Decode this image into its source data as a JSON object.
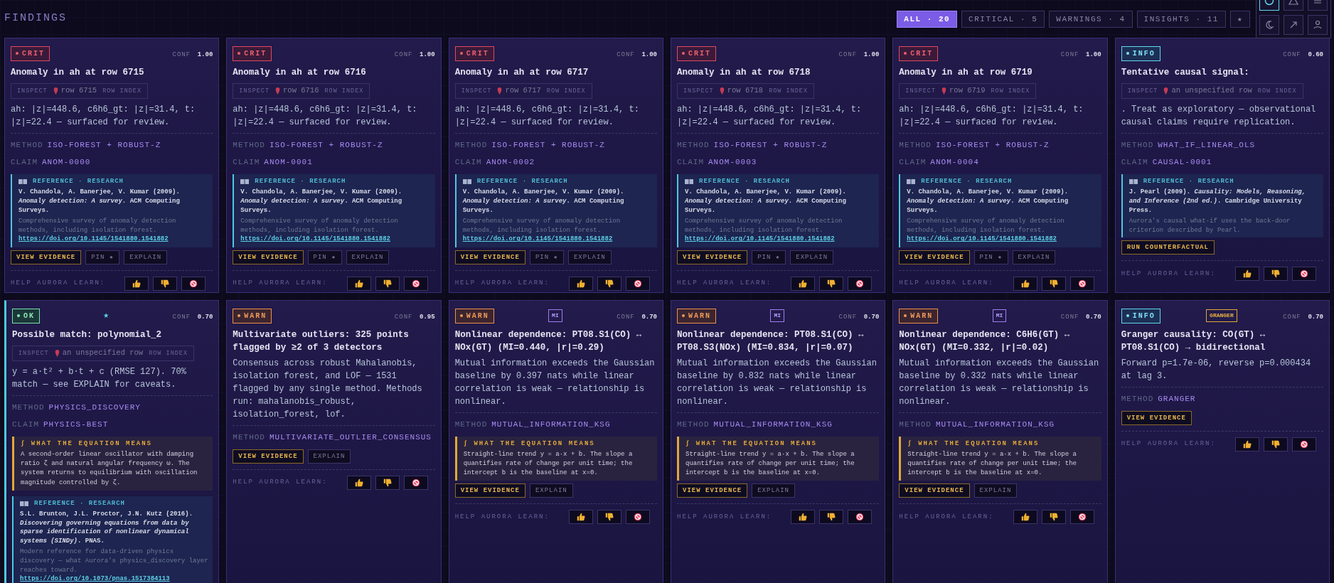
{
  "header": {
    "title": "FINDINGS"
  },
  "filters": [
    {
      "text": "ALL · 20",
      "selected": true
    },
    {
      "text": "CRITICAL · 5",
      "selected": false
    },
    {
      "text": "WARNINGS · 4",
      "selected": false
    },
    {
      "text": "INSIGHTS · 11",
      "selected": false
    },
    {
      "text": "★",
      "selected": false
    }
  ],
  "view_tools": [
    {
      "selected": true
    },
    {
      "selected": false
    },
    {
      "selected": false
    },
    {
      "selected": false
    },
    {
      "selected": false
    },
    {
      "selected": false
    }
  ],
  "cards": [
    {
      "kind": "crit",
      "badge": "CRIT",
      "conf_label": "CONF",
      "conf": "1.00",
      "title": "Anomaly in ah at row 6715",
      "inspect": {
        "label": "INSPECT",
        "row": "row 6715",
        "hint": "ROW INDEX"
      },
      "body": "ah: |z|=448.6, c6h6_gt: |z|=31.4, t: |z|=22.4 — surfaced for review.",
      "fields": [
        {
          "label": "METHOD",
          "value": "ISO-FOREST + ROBUST-Z"
        },
        {
          "label": "CLAIM",
          "value": "ANOM-0000"
        }
      ],
      "reference": {
        "header": "REFERENCE · RESEARCH",
        "citation": "V. Chandola, A. Banerjee, V. Kumar (2009). *Anomaly detection: A survey*. ACM Computing Surveys.",
        "note": "Comprehensive survey of anomaly detection methods, including isolation forest.",
        "url": "https://doi.org/10.1145/1541880.1541882"
      },
      "buttons": [
        {
          "text": "VIEW EVIDENCE",
          "kind": "primary"
        },
        {
          "text": "PIN ★",
          "kind": "secondary"
        },
        {
          "text": "EXPLAIN",
          "kind": "secondary"
        }
      ],
      "feedback": {
        "label": "HELP AURORA LEARN:"
      }
    },
    {
      "kind": "crit",
      "badge": "CRIT",
      "conf_label": "CONF",
      "conf": "1.00",
      "title": "Anomaly in ah at row 6716",
      "inspect": {
        "label": "INSPECT",
        "row": "row 6716",
        "hint": "ROW INDEX"
      },
      "body": "ah: |z|=448.6, c6h6_gt: |z|=31.4, t: |z|=22.4 — surfaced for review.",
      "fields": [
        {
          "label": "METHOD",
          "value": "ISO-FOREST + ROBUST-Z"
        },
        {
          "label": "CLAIM",
          "value": "ANOM-0001"
        }
      ],
      "reference": {
        "header": "REFERENCE · RESEARCH",
        "citation": "V. Chandola, A. Banerjee, V. Kumar (2009). *Anomaly detection: A survey*. ACM Computing Surveys.",
        "note": "Comprehensive survey of anomaly detection methods, including isolation forest.",
        "url": "https://doi.org/10.1145/1541880.1541882"
      },
      "buttons": [
        {
          "text": "VIEW EVIDENCE",
          "kind": "primary"
        },
        {
          "text": "PIN ★",
          "kind": "secondary"
        },
        {
          "text": "EXPLAIN",
          "kind": "secondary"
        }
      ],
      "feedback": {
        "label": "HELP AURORA LEARN:"
      }
    },
    {
      "kind": "crit",
      "badge": "CRIT",
      "conf_label": "CONF",
      "conf": "1.00",
      "title": "Anomaly in ah at row 6717",
      "inspect": {
        "label": "INSPECT",
        "row": "row 6717",
        "hint": "ROW INDEX"
      },
      "body": "ah: |z|=448.6, c6h6_gt: |z|=31.4, t: |z|=22.4 — surfaced for review.",
      "fields": [
        {
          "label": "METHOD",
          "value": "ISO-FOREST + ROBUST-Z"
        },
        {
          "label": "CLAIM",
          "value": "ANOM-0002"
        }
      ],
      "reference": {
        "header": "REFERENCE · RESEARCH",
        "citation": "V. Chandola, A. Banerjee, V. Kumar (2009). *Anomaly detection: A survey*. ACM Computing Surveys.",
        "note": "Comprehensive survey of anomaly detection methods, including isolation forest.",
        "url": "https://doi.org/10.1145/1541880.1541882"
      },
      "buttons": [
        {
          "text": "VIEW EVIDENCE",
          "kind": "primary"
        },
        {
          "text": "PIN ★",
          "kind": "secondary"
        },
        {
          "text": "EXPLAIN",
          "kind": "secondary"
        }
      ],
      "feedback": {
        "label": "HELP AURORA LEARN:"
      }
    },
    {
      "kind": "crit",
      "badge": "CRIT",
      "conf_label": "CONF",
      "conf": "1.00",
      "title": "Anomaly in ah at row 6718",
      "inspect": {
        "label": "INSPECT",
        "row": "row 6718",
        "hint": "ROW INDEX"
      },
      "body": "ah: |z|=448.6, c6h6_gt: |z|=31.4, t: |z|=22.4 — surfaced for review.",
      "fields": [
        {
          "label": "METHOD",
          "value": "ISO-FOREST + ROBUST-Z"
        },
        {
          "label": "CLAIM",
          "value": "ANOM-0003"
        }
      ],
      "reference": {
        "header": "REFERENCE · RESEARCH",
        "citation": "V. Chandola, A. Banerjee, V. Kumar (2009). *Anomaly detection: A survey*. ACM Computing Surveys.",
        "note": "Comprehensive survey of anomaly detection methods, including isolation forest.",
        "url": "https://doi.org/10.1145/1541880.1541882"
      },
      "buttons": [
        {
          "text": "VIEW EVIDENCE",
          "kind": "primary"
        },
        {
          "text": "PIN ★",
          "kind": "secondary"
        },
        {
          "text": "EXPLAIN",
          "kind": "secondary"
        }
      ],
      "feedback": {
        "label": "HELP AURORA LEARN:"
      }
    },
    {
      "kind": "crit",
      "badge": "CRIT",
      "conf_label": "CONF",
      "conf": "1.00",
      "title": "Anomaly in ah at row 6719",
      "inspect": {
        "label": "INSPECT",
        "row": "row 6719",
        "hint": "ROW INDEX"
      },
      "body": "ah: |z|=448.6, c6h6_gt: |z|=31.4, t: |z|=22.4 — surfaced for review.",
      "fields": [
        {
          "label": "METHOD",
          "value": "ISO-FOREST + ROBUST-Z"
        },
        {
          "label": "CLAIM",
          "value": "ANOM-0004"
        }
      ],
      "reference": {
        "header": "REFERENCE · RESEARCH",
        "citation": "V. Chandola, A. Banerjee, V. Kumar (2009). *Anomaly detection: A survey*. ACM Computing Surveys.",
        "note": "Comprehensive survey of anomaly detection methods, including isolation forest.",
        "url": "https://doi.org/10.1145/1541880.1541882"
      },
      "buttons": [
        {
          "text": "VIEW EVIDENCE",
          "kind": "primary"
        },
        {
          "text": "PIN ★",
          "kind": "secondary"
        },
        {
          "text": "EXPLAIN",
          "kind": "secondary"
        }
      ],
      "feedback": {
        "label": "HELP AURORA LEARN:"
      }
    },
    {
      "kind": "info",
      "badge": "INFO",
      "conf_label": "CONF",
      "conf": "0.60",
      "title": "Tentative causal signal:",
      "inspect": {
        "label": "INSPECT",
        "row": "an unspecified row",
        "hint": "ROW INDEX"
      },
      "body": ". Treat as exploratory — observational causal claims require replication.",
      "fields": [
        {
          "label": "METHOD",
          "value": "WHAT_IF_LINEAR_OLS"
        },
        {
          "label": "CLAIM",
          "value": "CAUSAL-0001"
        }
      ],
      "reference": {
        "header": "REFERENCE · RESEARCH",
        "citation": "J. Pearl (2009). *Causality: Models, Reasoning, and Inference (2nd ed.)*. Cambridge University Press.",
        "note": "Aurora's causal what-if uses the back-door criterion described by Pearl."
      },
      "buttons": [
        {
          "text": "RUN COUNTERFACTUAL",
          "kind": "primary"
        }
      ],
      "feedback": {
        "label": "HELP AURORA LEARN:"
      }
    },
    {
      "kind": "ok",
      "badge": "OK",
      "highlighted": true,
      "tag": {
        "kind": "star",
        "text": "★"
      },
      "conf_label": "CONF",
      "conf": "0.70",
      "title": "Possible match: polynomial_2",
      "inspect": {
        "label": "INSPECT",
        "row": "an unspecified row",
        "hint": "ROW INDEX"
      },
      "body": "y = a·t² + b·t + c (RMSE 127). 70% match — see EXPLAIN for caveats.",
      "fields": [
        {
          "label": "METHOD",
          "value": "PHYSICS_DISCOVERY"
        },
        {
          "label": "CLAIM",
          "value": "PHYSICS-BEST"
        }
      ],
      "explainer": {
        "header": "∫ WHAT THE EQUATION MEANS",
        "text": "A second-order linear oscillator with damping ratio ζ and natural angular frequency ω. The system returns to equilibrium with oscillation magnitude controlled by ζ."
      },
      "reference": {
        "header": "REFERENCE · RESEARCH",
        "citation": "S.L. Brunton, J.L. Proctor, J.N. Kutz (2016). *Discovering governing equations from data by sparse identification of nonlinear dynamical systems (SINDy)*. PNAS.",
        "note": "Modern reference for data-driven physics discovery — what Aurora's physics_discovery layer reaches toward.",
        "url": "https://doi.org/10.1073/pnas.1517384113"
      }
    },
    {
      "kind": "warn",
      "badge": "WARN",
      "conf_label": "CONF",
      "conf": "0.95",
      "title": "Multivariate outliers: 325 points flagged by ≥2 of 3 detectors",
      "body": "Consensus across robust Mahalanobis, isolation forest, and LOF — 1531 flagged by any single method. Methods run: mahalanobis_robust, isolation_forest, lof.",
      "fields": [
        {
          "label": "METHOD",
          "value": "MULTIVARIATE_OUTLIER_CONSENSUS"
        }
      ],
      "buttons": [
        {
          "text": "VIEW EVIDENCE",
          "kind": "primary"
        },
        {
          "text": "EXPLAIN",
          "kind": "secondary"
        }
      ],
      "feedback": {
        "label": "HELP AURORA LEARN:"
      }
    },
    {
      "kind": "warn",
      "badge": "WARN",
      "tag": {
        "kind": "mi",
        "text": "MI"
      },
      "conf_label": "CONF",
      "conf": "0.70",
      "title": "Nonlinear dependence: PT08.S1(CO) ↔ NOx(GT) (MI=0.440, |r|=0.29)",
      "body": "Mutual information exceeds the Gaussian baseline by 0.397 nats while linear correlation is weak — relationship is nonlinear.",
      "fields": [
        {
          "label": "METHOD",
          "value": "MUTUAL_INFORMATION_KSG"
        }
      ],
      "explainer": {
        "header": "∫ WHAT THE EQUATION MEANS",
        "text": "Straight-line trend y = a·x + b. The slope a quantifies rate of change per unit time; the intercept b is the baseline at x=0."
      },
      "buttons": [
        {
          "text": "VIEW EVIDENCE",
          "kind": "primary"
        },
        {
          "text": "EXPLAIN",
          "kind": "secondary"
        }
      ],
      "feedback": {
        "label": "HELP AURORA LEARN:"
      }
    },
    {
      "kind": "warn",
      "badge": "WARN",
      "tag": {
        "kind": "mi",
        "text": "MI"
      },
      "conf_label": "CONF",
      "conf": "0.70",
      "title": "Nonlinear dependence: PT08.S1(CO) ↔ PT08.S3(NOx) (MI=0.834, |r|=0.07)",
      "body": "Mutual information exceeds the Gaussian baseline by 0.832 nats while linear correlation is weak — relationship is nonlinear.",
      "fields": [
        {
          "label": "METHOD",
          "value": "MUTUAL_INFORMATION_KSG"
        }
      ],
      "explainer": {
        "header": "∫ WHAT THE EQUATION MEANS",
        "text": "Straight-line trend y = a·x + b. The slope a quantifies rate of change per unit time; the intercept b is the baseline at x=0."
      },
      "buttons": [
        {
          "text": "VIEW EVIDENCE",
          "kind": "primary"
        },
        {
          "text": "EXPLAIN",
          "kind": "secondary"
        }
      ],
      "feedback": {
        "label": "HELP AURORA LEARN:"
      }
    },
    {
      "kind": "warn",
      "badge": "WARN",
      "tag": {
        "kind": "mi",
        "text": "MI"
      },
      "conf_label": "CONF",
      "conf": "0.70",
      "title": "Nonlinear dependence: C6H6(GT) ↔ NOx(GT) (MI=0.332, |r|=0.02)",
      "body": "Mutual information exceeds the Gaussian baseline by 0.332 nats while linear correlation is weak — relationship is nonlinear.",
      "fields": [
        {
          "label": "METHOD",
          "value": "MUTUAL_INFORMATION_KSG"
        }
      ],
      "explainer": {
        "header": "∫ WHAT THE EQUATION MEANS",
        "text": "Straight-line trend y = a·x + b. The slope a quantifies rate of change per unit time; the intercept b is the baseline at x=0."
      },
      "buttons": [
        {
          "text": "VIEW EVIDENCE",
          "kind": "primary"
        },
        {
          "text": "EXPLAIN",
          "kind": "secondary"
        }
      ],
      "feedback": {
        "label": "HELP AURORA LEARN:"
      }
    },
    {
      "kind": "info",
      "badge": "INFO",
      "tag": {
        "kind": "granger",
        "text": "GRANGER"
      },
      "conf_label": "CONF",
      "conf": "0.70",
      "title": "Granger causality: CO(GT) ↔ PT08.S1(CO) → bidirectional",
      "body": "Forward p=1.7e-06, reverse p=0.000434 at lag 3.",
      "fields": [
        {
          "label": "METHOD",
          "value": "GRANGER"
        }
      ],
      "buttons": [
        {
          "text": "VIEW EVIDENCE",
          "kind": "primary"
        }
      ],
      "feedback": {
        "label": "HELP AURORA LEARN:"
      }
    }
  ]
}
